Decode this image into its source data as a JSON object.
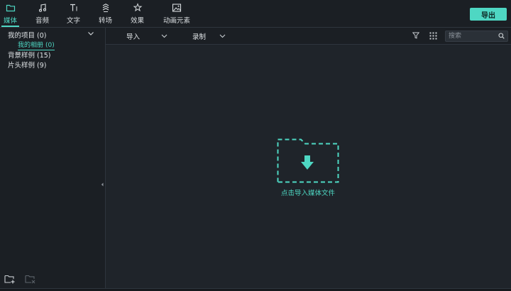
{
  "toolbar": {
    "tabs": [
      {
        "label": "媒体",
        "icon": "folder-icon",
        "active": true
      },
      {
        "label": "音频",
        "icon": "music-note-icon",
        "active": false
      },
      {
        "label": "文字",
        "icon": "text-icon",
        "active": false
      },
      {
        "label": "转场",
        "icon": "transition-icon",
        "active": false
      },
      {
        "label": "效果",
        "icon": "effects-icon",
        "active": false
      },
      {
        "label": "动画元素",
        "icon": "image-icon",
        "active": false
      }
    ],
    "export_label": "导出"
  },
  "sidebar": {
    "my_project": {
      "label": "我的项目",
      "count": "(0)"
    },
    "my_album": {
      "label": "我的相册",
      "count": "(0)"
    },
    "background_samples": {
      "label": "背景样例",
      "count": "(15)"
    },
    "intro_samples": {
      "label": "片头样例",
      "count": "(9)"
    }
  },
  "subbar": {
    "import_label": "导入",
    "record_label": "录制",
    "search_placeholder": "搜索"
  },
  "main": {
    "drop_hint": "点击导入媒体文件"
  },
  "colors": {
    "accent": "#4ed7c3",
    "background": "#1f242a",
    "panel": "#1b1f24"
  }
}
